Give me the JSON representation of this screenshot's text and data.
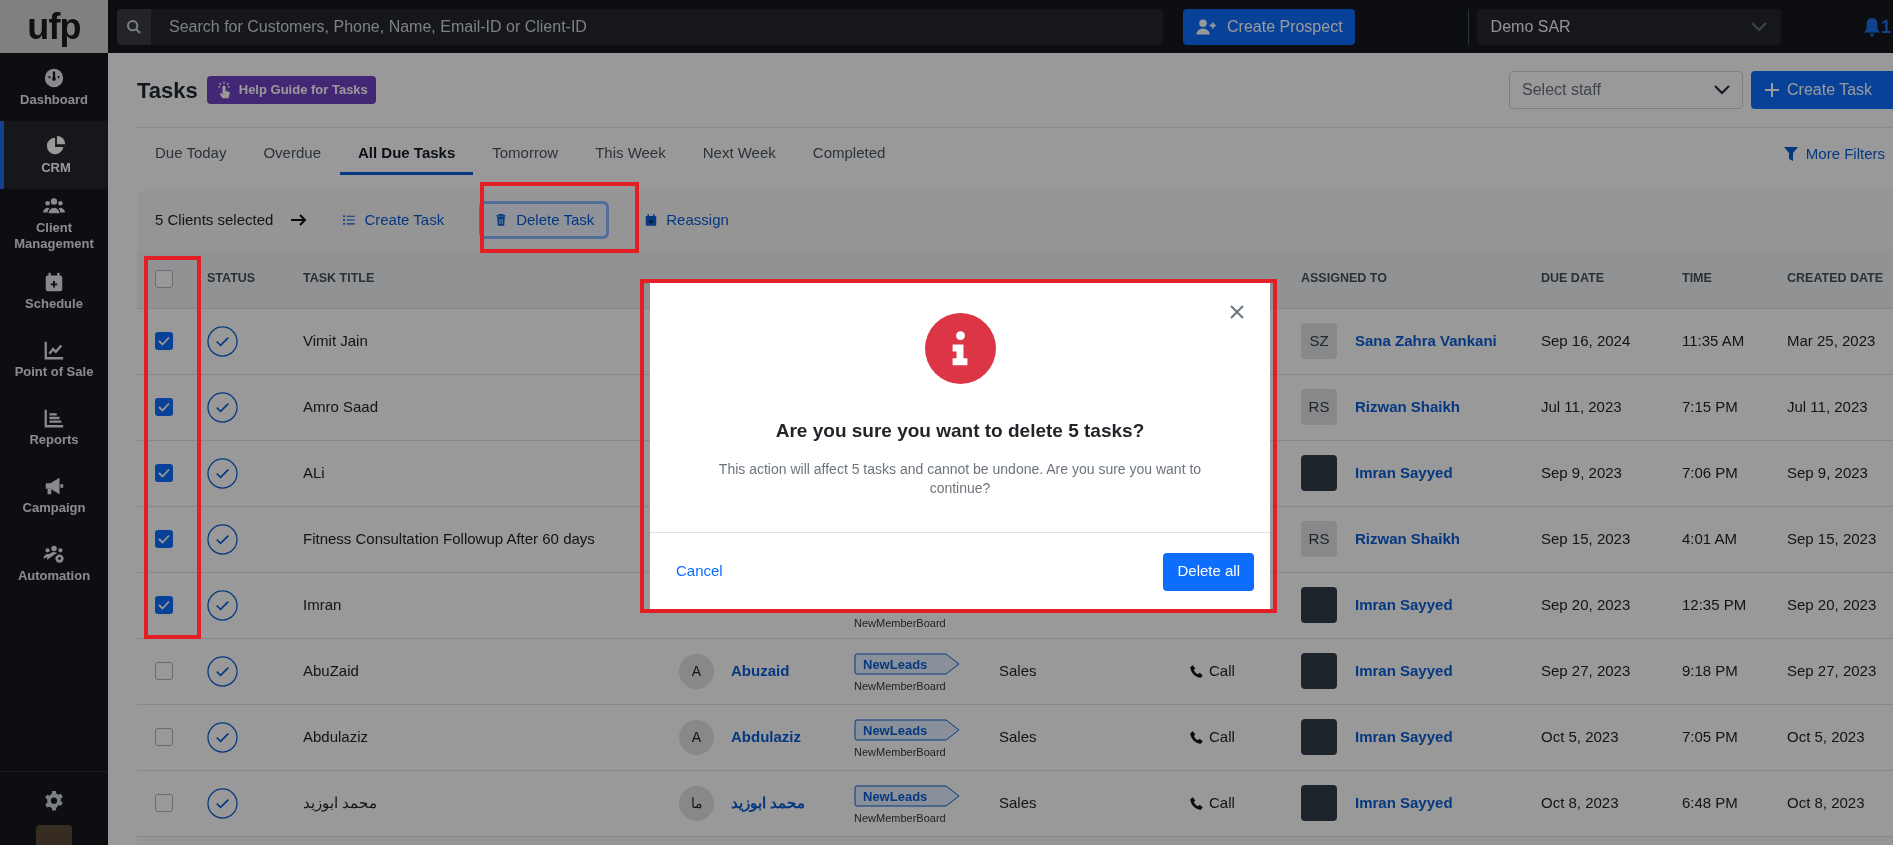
{
  "topbar": {
    "logo": "ufp",
    "search": {
      "placeholder": "Search for Customers, Phone, Name, Email-ID or Client-ID"
    },
    "create_button": "Create Prospect",
    "location_select": "Demo SAR",
    "notification_count": "1"
  },
  "sidebar": {
    "items": [
      {
        "kind": "gauge",
        "label": "Dashboard",
        "selected": false
      },
      {
        "kind": "pie",
        "label": "CRM",
        "selected": true
      },
      {
        "kind": "users",
        "label": "Client Management",
        "selected": false
      },
      {
        "kind": "calendar",
        "label": "Schedule",
        "selected": false
      },
      {
        "kind": "chart",
        "label": "Point of Sale",
        "selected": false
      },
      {
        "kind": "bars",
        "label": "Reports",
        "selected": false
      },
      {
        "kind": "megaphone",
        "label": "Campaign",
        "selected": false
      },
      {
        "kind": "usersgear",
        "label": "Automation",
        "selected": false
      }
    ]
  },
  "page": {
    "title": "Tasks",
    "help_button": "Help Guide for Tasks",
    "staff_select": {
      "placeholder": "Select staff"
    },
    "create_task_button": "Create Task"
  },
  "tabs": [
    {
      "label": "Due Today",
      "selected": false
    },
    {
      "label": "Overdue",
      "selected": false
    },
    {
      "label": "All Due Tasks",
      "selected": true
    },
    {
      "label": "Tomorrow",
      "selected": false
    },
    {
      "label": "This Week",
      "selected": false
    },
    {
      "label": "Next Week",
      "selected": false
    },
    {
      "label": "Completed",
      "selected": false
    }
  ],
  "more_filters": "More Filters",
  "bulk_bar": {
    "selection": "5 Clients selected",
    "actions": [
      {
        "kind": "list",
        "label": "Create Task",
        "focused": false
      },
      {
        "kind": "trash",
        "label": "Delete Task",
        "focused": true
      },
      {
        "kind": "calendar",
        "label": "Reassign",
        "focused": false
      }
    ]
  },
  "table": {
    "select_all_checked": false,
    "columns": [
      "STATUS",
      "TASK TITLE",
      "ASSIGNED TO",
      "DUE DATE",
      "TIME",
      "CREATED DATE"
    ],
    "rows": [
      {
        "checked": true,
        "title": "Vimit Jain",
        "assignee": {
          "kind": "initials",
          "initials": "SZ",
          "name": "Sana Zahra Vankani"
        },
        "due": "Sep 16, 2024",
        "time": "11:35 AM",
        "created": "Mar 25, 2023"
      },
      {
        "checked": true,
        "title": "Amro Saad",
        "assignee": {
          "kind": "initials",
          "initials": "RS",
          "name": "Rizwan Shaikh"
        },
        "due": "Jul 11, 2023",
        "time": "7:15 PM",
        "created": "Jul 11, 2023"
      },
      {
        "checked": true,
        "title": "ALi",
        "assignee": {
          "kind": "photo",
          "name": "Imran Sayyed"
        },
        "due": "Sep 9, 2023",
        "time": "7:06 PM",
        "created": "Sep 9, 2023"
      },
      {
        "checked": true,
        "title": "Fitness Consultation Followup After 60 days",
        "assignee": {
          "kind": "initials",
          "initials": "RS",
          "name": "Rizwan Shaikh"
        },
        "due": "Sep 15, 2023",
        "time": "4:01 AM",
        "created": "Sep 15, 2023"
      },
      {
        "checked": true,
        "title": "Imran",
        "opportunity": {
          "board": "NewMemberBoard"
        },
        "assignee": {
          "kind": "photo",
          "name": "Imran Sayyed"
        },
        "due": "Sep 20, 2023",
        "time": "12:35 PM",
        "created": "Sep 20, 2023"
      },
      {
        "checked": false,
        "title": "AbuZaid",
        "contact": {
          "initials": "A",
          "name": "Abuzaid"
        },
        "opportunity": {
          "stage": "NewLeads",
          "board": "NewMemberBoard"
        },
        "category": "Sales",
        "type": "Call",
        "assignee": {
          "kind": "photo",
          "name": "Imran Sayyed"
        },
        "due": "Sep 27, 2023",
        "time": "9:18 PM",
        "created": "Sep 27, 2023"
      },
      {
        "checked": false,
        "title": "Abdulaziz",
        "contact": {
          "initials": "A",
          "name": "Abdulaziz"
        },
        "opportunity": {
          "stage": "NewLeads",
          "board": "NewMemberBoard"
        },
        "category": "Sales",
        "type": "Call",
        "assignee": {
          "kind": "photo",
          "name": "Imran Sayyed"
        },
        "due": "Oct 5, 2023",
        "time": "7:05 PM",
        "created": "Oct 5, 2023"
      },
      {
        "checked": false,
        "title": "محمد ابوزيد",
        "contact": {
          "initials": "ما",
          "name": "محمد ابوزيد"
        },
        "opportunity": {
          "stage": "NewLeads",
          "board": "NewMemberBoard"
        },
        "category": "Sales",
        "type": "Call",
        "assignee": {
          "kind": "photo",
          "name": "Imran Sayyed"
        },
        "due": "Oct 8, 2023",
        "time": "6:48 PM",
        "created": "Oct 8, 2023"
      }
    ]
  },
  "modal": {
    "title": "Are you sure you want to delete 5 tasks?",
    "message": "This action will affect 5 tasks and cannot be undone. Are you sure you want to continue?",
    "cancel": "Cancel",
    "confirm": "Delete all"
  }
}
